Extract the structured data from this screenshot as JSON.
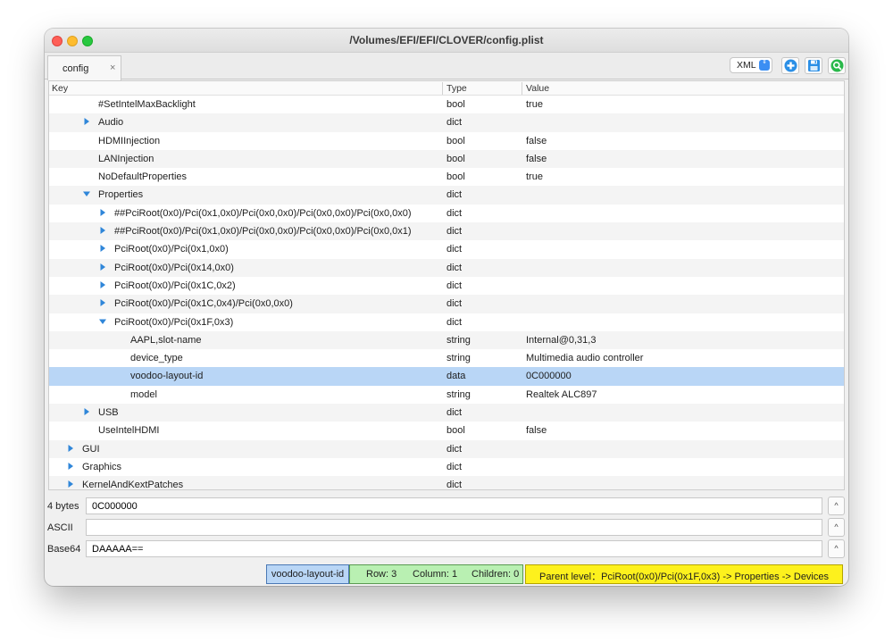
{
  "window": {
    "title": "/Volumes/EFI/EFI/CLOVER/config.plist"
  },
  "tabs": [
    {
      "label": "config",
      "close": "×"
    }
  ],
  "toolbar": {
    "format_value": "XML",
    "format_arrows": "⇕"
  },
  "icons": {
    "add": "plus-circle-icon",
    "save": "floppy-disk-icon",
    "search": "search-icon",
    "expand_arrow": "triangle-right-icon",
    "collapse_arrow": "triangle-down-icon",
    "field_expand": "chevron-up-icon"
  },
  "colors": {
    "selection": "#b9d6f6",
    "tree_arrow": "#2f86d9",
    "status_name": "#b9d6f6",
    "status_position": "#b9f0b2",
    "status_parent": "#fdf11d"
  },
  "columns": {
    "key": "Key",
    "type": "Type",
    "value": "Value"
  },
  "rows": [
    {
      "key": "#SetIntelMaxBacklight",
      "type": "bool",
      "value": "true",
      "depth": 2,
      "arrow": "none"
    },
    {
      "key": "Audio",
      "type": "dict",
      "value": "",
      "depth": 2,
      "arrow": "collapsed"
    },
    {
      "key": "HDMIInjection",
      "type": "bool",
      "value": "false",
      "depth": 2,
      "arrow": "none"
    },
    {
      "key": "LANInjection",
      "type": "bool",
      "value": "false",
      "depth": 2,
      "arrow": "none"
    },
    {
      "key": "NoDefaultProperties",
      "type": "bool",
      "value": "true",
      "depth": 2,
      "arrow": "none"
    },
    {
      "key": "Properties",
      "type": "dict",
      "value": "",
      "depth": 2,
      "arrow": "expanded"
    },
    {
      "key": "##PciRoot(0x0)/Pci(0x1,0x0)/Pci(0x0,0x0)/Pci(0x0,0x0)/Pci(0x0,0x0)",
      "type": "dict",
      "value": "",
      "depth": 3,
      "arrow": "collapsed"
    },
    {
      "key": "##PciRoot(0x0)/Pci(0x1,0x0)/Pci(0x0,0x0)/Pci(0x0,0x0)/Pci(0x0,0x1)",
      "type": "dict",
      "value": "",
      "depth": 3,
      "arrow": "collapsed"
    },
    {
      "key": "PciRoot(0x0)/Pci(0x1,0x0)",
      "type": "dict",
      "value": "",
      "depth": 3,
      "arrow": "collapsed"
    },
    {
      "key": "PciRoot(0x0)/Pci(0x14,0x0)",
      "type": "dict",
      "value": "",
      "depth": 3,
      "arrow": "collapsed"
    },
    {
      "key": "PciRoot(0x0)/Pci(0x1C,0x2)",
      "type": "dict",
      "value": "",
      "depth": 3,
      "arrow": "collapsed"
    },
    {
      "key": "PciRoot(0x0)/Pci(0x1C,0x4)/Pci(0x0,0x0)",
      "type": "dict",
      "value": "",
      "depth": 3,
      "arrow": "collapsed"
    },
    {
      "key": "PciRoot(0x0)/Pci(0x1F,0x3)",
      "type": "dict",
      "value": "",
      "depth": 3,
      "arrow": "expanded"
    },
    {
      "key": "AAPL,slot-name",
      "type": "string",
      "value": "Internal@0,31,3",
      "depth": 4,
      "arrow": "none"
    },
    {
      "key": "device_type",
      "type": "string",
      "value": "Multimedia audio controller",
      "depth": 4,
      "arrow": "none"
    },
    {
      "key": "voodoo-layout-id",
      "type": "data",
      "value": "0C000000",
      "depth": 4,
      "arrow": "none",
      "selected": true
    },
    {
      "key": "model",
      "type": "string",
      "value": "Realtek ALC897",
      "depth": 4,
      "arrow": "none"
    },
    {
      "key": "USB",
      "type": "dict",
      "value": "",
      "depth": 2,
      "arrow": "collapsed"
    },
    {
      "key": "UseIntelHDMI",
      "type": "bool",
      "value": "false",
      "depth": 2,
      "arrow": "none"
    },
    {
      "key": "GUI",
      "type": "dict",
      "value": "",
      "depth": 1,
      "arrow": "collapsed"
    },
    {
      "key": "Graphics",
      "type": "dict",
      "value": "",
      "depth": 1,
      "arrow": "collapsed"
    },
    {
      "key": "KernelAndKextPatches",
      "type": "dict",
      "value": "",
      "depth": 1,
      "arrow": "collapsed"
    }
  ],
  "editors": {
    "bytes": {
      "label": "4 bytes",
      "value": "0C000000",
      "button": "^"
    },
    "ascii": {
      "label": "ASCII",
      "value": "",
      "button": "^"
    },
    "base64": {
      "label": "Base64",
      "value": "DAAAAA==",
      "button": "^"
    }
  },
  "status": {
    "item_name": "voodoo-layout-id",
    "row": "Row: 3",
    "column": "Column: 1",
    "children": "Children: 0",
    "parent": "Parent level：PciRoot(0x0)/Pci(0x1F,0x3) -> Properties -> Devices"
  }
}
